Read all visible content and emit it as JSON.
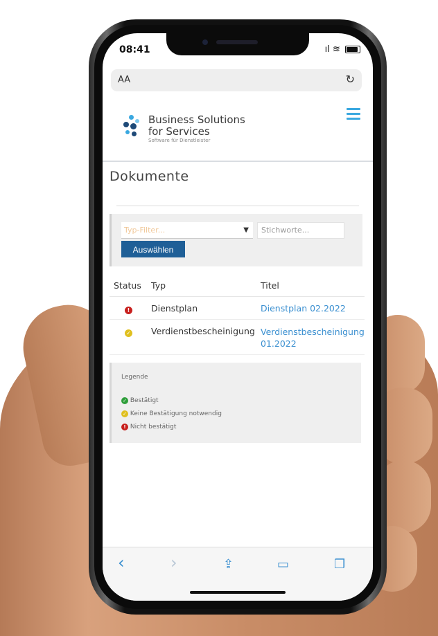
{
  "status_bar": {
    "time": "08:41",
    "signal": "ıl",
    "wifi": "≋"
  },
  "urlbar": {
    "text_size_label": "AA",
    "reload_glyph": "↻"
  },
  "brand": {
    "line1": "Business Solutions",
    "line2": "for Services",
    "tagline": "Software für Dienstleister"
  },
  "page": {
    "title": "Dokumente"
  },
  "filter": {
    "type_placeholder": "Typ-Filter...",
    "keywords_placeholder": "Stichworte...",
    "select_button": "Auswählen"
  },
  "table": {
    "headers": [
      "Status",
      "Typ",
      "Titel"
    ],
    "rows": [
      {
        "status": "nicht-bestaetigt",
        "typ": "Dienstplan",
        "titel": "Dienstplan 02.2022"
      },
      {
        "status": "keine-bestaetigung",
        "typ": "Verdienstbescheinigung",
        "titel": "Verdienstbescheinigung 01.2022"
      }
    ]
  },
  "legend": {
    "title": "Legende",
    "items": [
      {
        "label": "Bestätigt",
        "color": "#2e9e3a"
      },
      {
        "label": "Keine Bestätigung notwendig",
        "color": "#e0c020"
      },
      {
        "label": "Nicht bestätigt",
        "color": "#c8201e"
      }
    ]
  },
  "colors": {
    "accent": "#3a8fd0",
    "button": "#1f5f97"
  },
  "safari_toolbar": {
    "back": "‹",
    "forward": "›",
    "share": "⇪",
    "bookmarks": "▭",
    "tabs": "❐"
  }
}
